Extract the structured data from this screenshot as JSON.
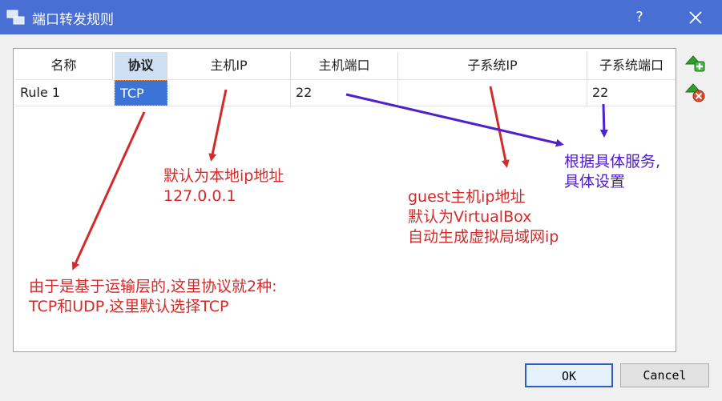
{
  "window": {
    "title": "端口转发规则",
    "help_label": "?"
  },
  "table": {
    "columns": [
      "名称",
      "协议",
      "主机IP",
      "主机端口",
      "子系统IP",
      "子系统端口"
    ],
    "active_column": "协议",
    "rows": [
      {
        "name": "Rule 1",
        "protocol": "TCP",
        "host_ip": "",
        "host_port": "22",
        "guest_ip": "",
        "guest_port": "22"
      }
    ]
  },
  "side_buttons": {
    "add_icon": "add-rule-icon",
    "remove_icon": "remove-rule-icon"
  },
  "annotations": {
    "host_ip": [
      "默认为本地ip地址",
      "127.0.0.1"
    ],
    "guest_ip": [
      "guest主机ip地址",
      "默认为VirtualBox",
      "自动生成虚拟局域网ip"
    ],
    "guest_port": [
      "根据具体服务,",
      "具体设置"
    ],
    "protocol": [
      "由于是基于运输层的,这里协议就2种:",
      "TCP和UDP,这里默认选择TCP"
    ]
  },
  "colors": {
    "annotation_red": "#d42a2a",
    "annotation_purple": "#5020c8",
    "title_bar": "#4a6fd4",
    "selection": "#3b73d6"
  },
  "buttons": {
    "ok": "OK",
    "cancel": "Cancel"
  }
}
